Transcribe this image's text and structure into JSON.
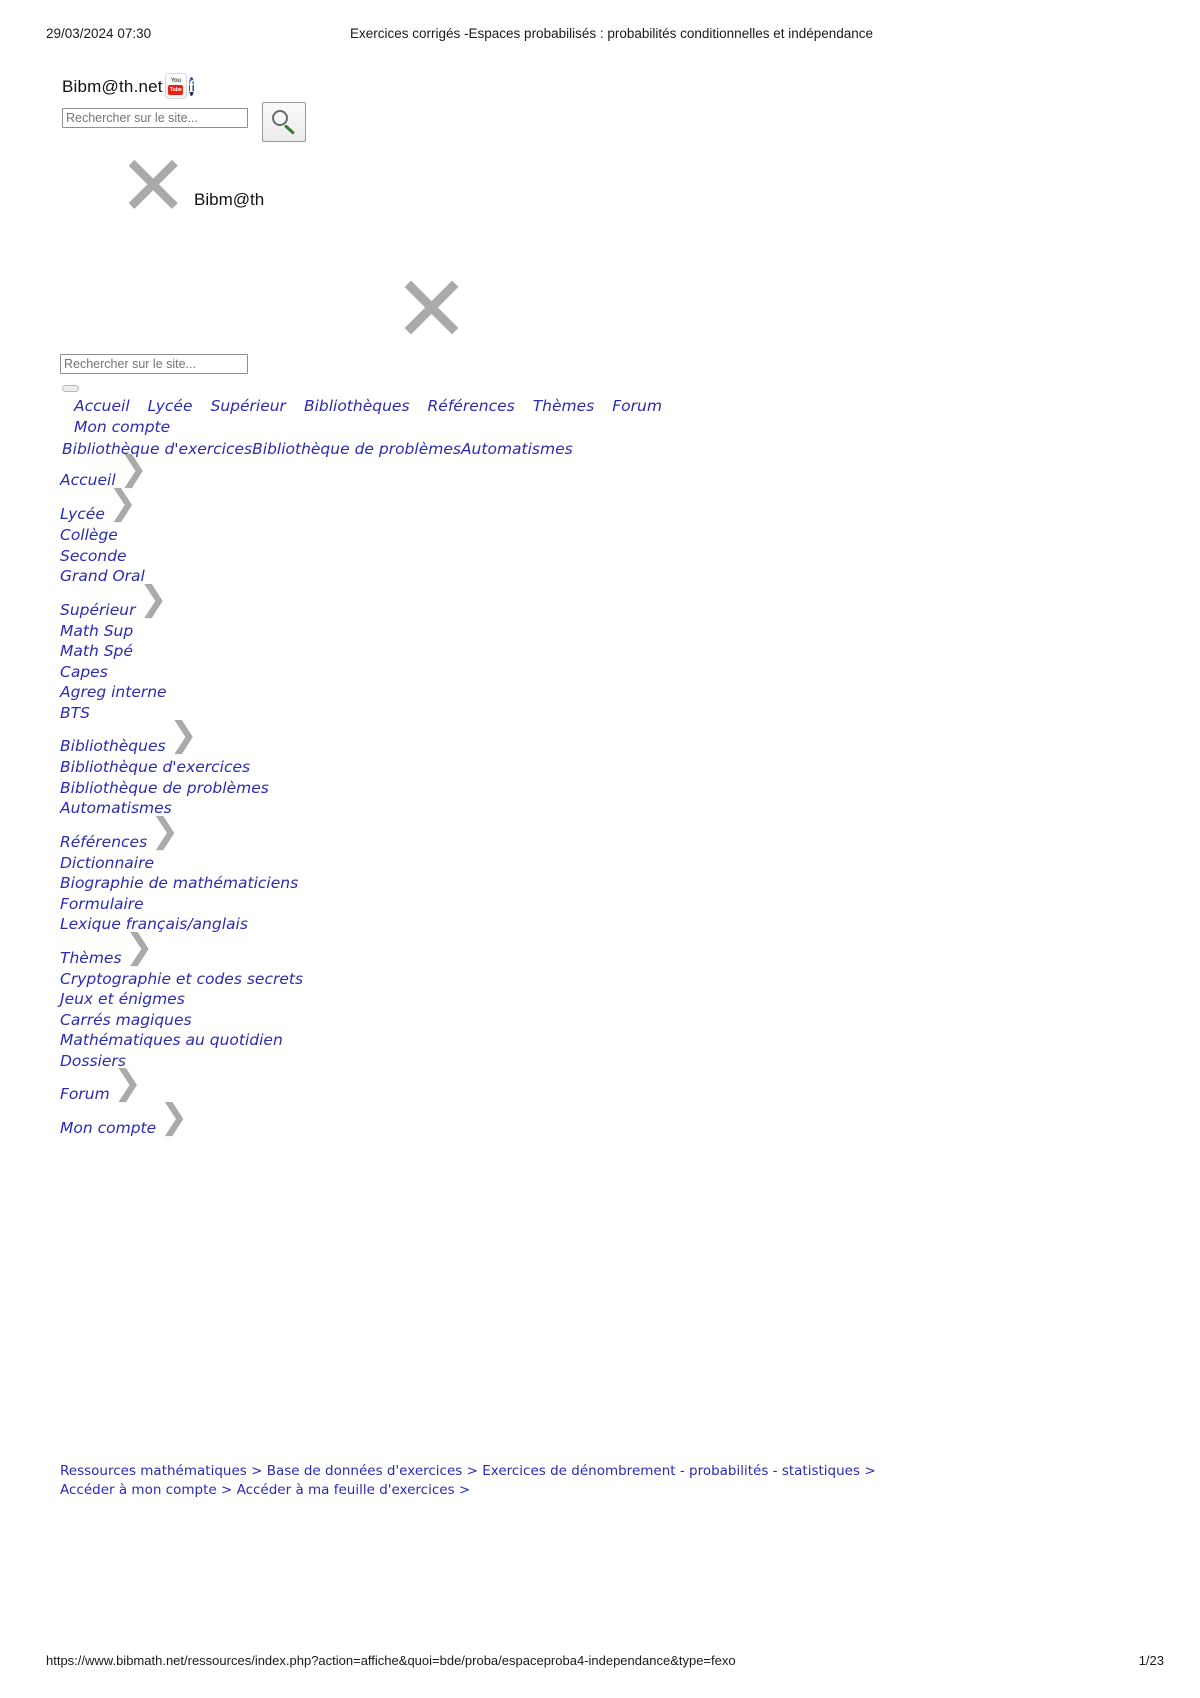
{
  "print_header": {
    "date": "29/03/2024 07:30",
    "title": "Exercices corrigés -Espaces probabilisés : probabilités conditionnelles et indépendance"
  },
  "header": {
    "brand": "Bibm@th.net",
    "social": [
      {
        "name": "youtube-icon",
        "top": "You",
        "box": "Tube"
      },
      {
        "name": "facebook-icon",
        "glyph": "f"
      },
      {
        "name": "accessibility-icon",
        "glyph": ""
      }
    ],
    "search": {
      "value": "",
      "placeholder": "Rechercher sur le site...",
      "button_icon": "search-icon"
    }
  },
  "broken_images": {
    "logo_alt": "Bibm@th",
    "x_glyph": "✕",
    "banner_alt": ""
  },
  "search_secondary": {
    "value": "",
    "placeholder": "Rechercher sur le site..."
  },
  "nav": {
    "items": [
      "Accueil",
      "Lycée",
      "Supérieur",
      "Bibliothèques",
      "Références",
      "Thèmes",
      "Forum"
    ],
    "account": "Mon compte",
    "inline_sub": [
      "Bibliothèque d'exercices",
      "Bibliothèque de problèmes",
      "Automatismes"
    ]
  },
  "menu_tree": {
    "chevron": "❯",
    "groups": [
      {
        "head": "Accueil",
        "items": []
      },
      {
        "head": "Lycée",
        "items": [
          "Collège",
          "Seconde",
          "Grand Oral"
        ]
      },
      {
        "head": "Supérieur",
        "items": [
          "Math Sup",
          "Math Spé",
          "Capes",
          "Agreg interne",
          "BTS"
        ]
      },
      {
        "head": "Bibliothèques",
        "items": [
          "Bibliothèque d'exercices",
          "Bibliothèque de problèmes",
          "Automatismes"
        ]
      },
      {
        "head": "Références",
        "items": [
          "Dictionnaire",
          "Biographie de mathématiciens",
          "Formulaire",
          "Lexique français/anglais"
        ]
      },
      {
        "head": "Thèmes",
        "items": [
          "Cryptographie et codes secrets",
          "Jeux et énigmes",
          "Carrés magiques",
          "Mathématiques au quotidien",
          "Dossiers"
        ]
      },
      {
        "head": "Forum",
        "items": []
      },
      {
        "head": "Mon compte",
        "items": []
      }
    ]
  },
  "footer_links": {
    "line1": [
      {
        "label": "Ressources mathématiques",
        "sep": ">"
      },
      {
        "label": "Base de données d'exercices",
        "sep": ">"
      },
      {
        "label": "Exercices de dénombrement - probabilités - statistiques",
        "sep": ">"
      }
    ],
    "line2": [
      {
        "label": "Accéder à mon compte",
        "sep": ">"
      },
      {
        "label": "Accéder à ma feuille d'exercices",
        "sep": ">"
      }
    ]
  },
  "print_footer": {
    "url": "https://www.bibmath.net/ressources/index.php?action=affiche&quoi=bde/proba/espaceproba4-independance&type=fexo",
    "page": "1/23"
  },
  "colors": {
    "link": "#2b2bb0",
    "broken_placeholder": "#aaaaaa",
    "text": "#111111"
  }
}
